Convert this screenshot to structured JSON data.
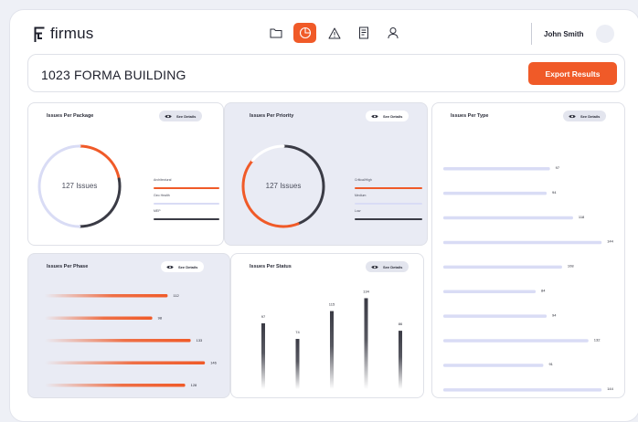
{
  "app": {
    "brand": "firmus",
    "user_name": "John Smith"
  },
  "nav": [
    {
      "name": "folder-icon",
      "active": false
    },
    {
      "name": "pie-chart-icon",
      "active": true
    },
    {
      "name": "warning-icon",
      "active": false
    },
    {
      "name": "document-icon",
      "active": false
    },
    {
      "name": "user-icon",
      "active": false
    }
  ],
  "header": {
    "title": "1023 FORMA BUILDING",
    "export_label": "Export Results"
  },
  "colors": {
    "accent": "#f05a28",
    "dark": "#3a3b45",
    "lavender": "#d9dcf5",
    "tint": "#e9ebf4"
  },
  "see_details_label": "See Details",
  "panels": {
    "package": {
      "title": "Issues Per Package",
      "center_label": "127 Issues",
      "segments": [
        {
          "fraction": 0.22,
          "color": "#f05a28"
        },
        {
          "fraction": 0.28,
          "color": "#3a3b45"
        },
        {
          "fraction": 0.5,
          "color": "#d9dcf5"
        }
      ],
      "legend": [
        {
          "label": "Architectural",
          "color": "#f05a28"
        },
        {
          "label": "Geo Health",
          "color": "#d9dcf5"
        },
        {
          "label": "MEP",
          "color": "#3a3b45"
        }
      ]
    },
    "priority": {
      "title": "Issues Per Priority",
      "center_label": "127 Issues",
      "segments": [
        {
          "fraction": 0.44,
          "color": "#3a3b45"
        },
        {
          "fraction": 0.42,
          "color": "#f05a28"
        },
        {
          "fraction": 0.14,
          "color": "#ffffff"
        }
      ],
      "legend": [
        {
          "label": "Critical/High",
          "color": "#f05a28"
        },
        {
          "label": "Medium",
          "color": "#d9dcf5"
        },
        {
          "label": "Low",
          "color": "#3a3b45"
        }
      ]
    }
  },
  "chart_data": [
    {
      "type": "bar",
      "orientation": "horizontal",
      "title": "Issues Per Phase",
      "values": [
        112,
        98,
        133,
        146,
        128
      ]
    },
    {
      "type": "bar",
      "orientation": "vertical",
      "title": "Issues Per Status",
      "values": [
        97,
        74,
        115,
        134,
        86
      ]
    },
    {
      "type": "bar",
      "orientation": "horizontal",
      "title": "Issues Per Type",
      "values": [
        97,
        94,
        118,
        144,
        108,
        84,
        94,
        132,
        91,
        144
      ]
    }
  ]
}
